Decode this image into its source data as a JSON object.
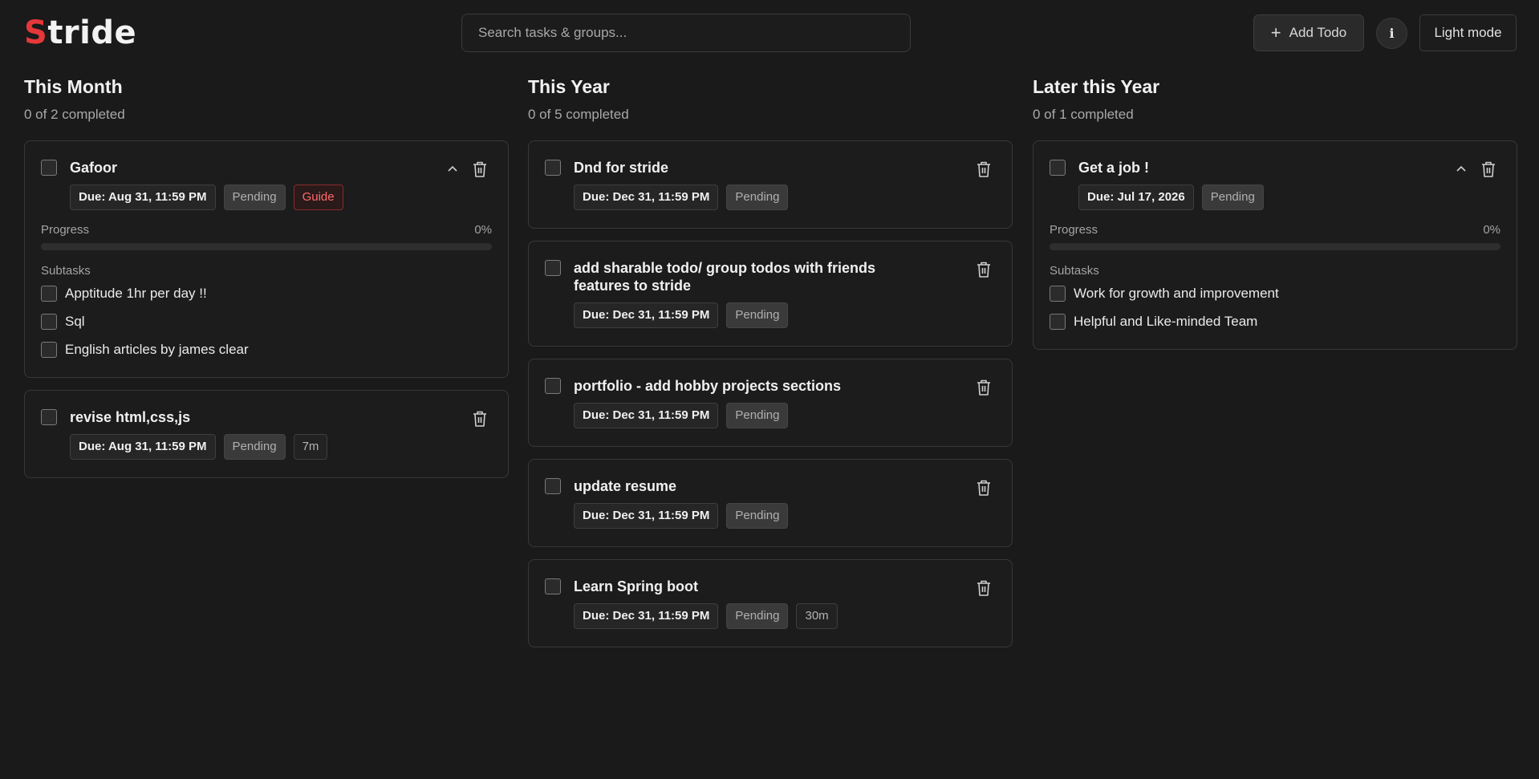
{
  "app": {
    "logo_first": "S",
    "logo_rest": "tride",
    "accent": "#e5383b"
  },
  "header": {
    "search_placeholder": "Search tasks & groups...",
    "add_label": "Add Todo",
    "info_label": "i",
    "theme_label": "Light mode"
  },
  "columns": [
    {
      "title": "This Month",
      "count": "0 of 2 completed",
      "tasks": [
        {
          "title": "Gafoor",
          "due": "Due: Aug 31, 11:59 PM",
          "status": "Pending",
          "tag": "Guide",
          "progress_label": "Progress",
          "progress_value": "0%",
          "progress": 0,
          "subtasks_label": "Subtasks",
          "subtasks": [
            "Apptitude 1hr per day !!",
            "Sql",
            "English articles by james clear"
          ]
        },
        {
          "title": "revise html,css,js",
          "due": "Due: Aug 31, 11:59 PM",
          "status": "Pending",
          "time": "7m"
        }
      ]
    },
    {
      "title": "This Year",
      "count": "0 of 5 completed",
      "tasks": [
        {
          "title": "Dnd for stride",
          "due": "Due: Dec 31, 11:59 PM",
          "status": "Pending"
        },
        {
          "title": "add sharable todo/ group todos with friends features to stride",
          "due": "Due: Dec 31, 11:59 PM",
          "status": "Pending"
        },
        {
          "title": "portfolio - add hobby projects sections",
          "due": "Due: Dec 31, 11:59 PM",
          "status": "Pending"
        },
        {
          "title": "update resume",
          "due": "Due: Dec 31, 11:59 PM",
          "status": "Pending"
        },
        {
          "title": "Learn Spring boot",
          "due": "Due: Dec 31, 11:59 PM",
          "status": "Pending",
          "time": "30m"
        }
      ]
    },
    {
      "title": "Later this Year",
      "count": "0 of 1 completed",
      "tasks": [
        {
          "title": "Get a job !",
          "due": "Due: Jul 17, 2026",
          "status": "Pending",
          "progress_label": "Progress",
          "progress_value": "0%",
          "progress": 0,
          "subtasks_label": "Subtasks",
          "subtasks": [
            "Work for growth and improvement",
            "Helpful and Like-minded Team"
          ]
        }
      ]
    }
  ]
}
